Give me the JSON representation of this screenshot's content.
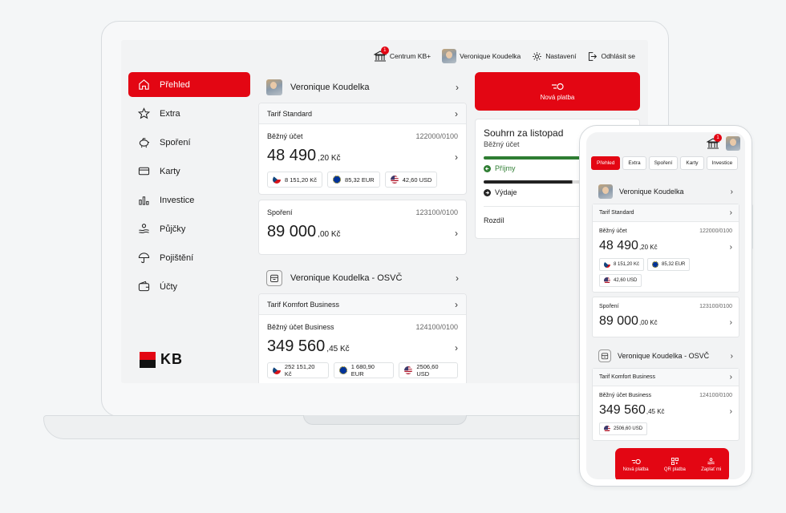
{
  "topbar": {
    "centrum_label": "Centrum KB+",
    "notification_count": "1",
    "user_name": "Veronique Koudelka",
    "settings_label": "Nastavení",
    "logout_label": "Odhlásit se"
  },
  "sidebar": {
    "items": [
      {
        "label": "Přehled",
        "icon": "home-icon"
      },
      {
        "label": "Extra",
        "icon": "star-icon"
      },
      {
        "label": "Spoření",
        "icon": "piggy-bank-icon"
      },
      {
        "label": "Karty",
        "icon": "card-icon"
      },
      {
        "label": "Investice",
        "icon": "bar-chart-icon"
      },
      {
        "label": "Půjčky",
        "icon": "loan-icon"
      },
      {
        "label": "Pojištění",
        "icon": "umbrella-icon"
      },
      {
        "label": "Účty",
        "icon": "wallet-icon"
      }
    ],
    "logo_text": "KB"
  },
  "accounts": {
    "personal": {
      "owner": "Veronique Koudelka",
      "tarif": "Tarif Standard",
      "current": {
        "name": "Běžný účet",
        "number": "122000/0100",
        "balance_int": "48 490",
        "balance_dec": ",20 Kč",
        "currencies": [
          "8 151,20 Kč",
          "85,32 EUR",
          "42,60 USD"
        ]
      },
      "savings": {
        "name": "Spoření",
        "number": "123100/0100",
        "balance_int": "89 000",
        "balance_dec": ",00 Kč"
      }
    },
    "business": {
      "owner": "Veronique Koudelka - OSVČ",
      "tarif": "Tarif Komfort Business",
      "current": {
        "name": "Běžný účet Business",
        "number": "124100/0100",
        "balance_int": "349 560",
        "balance_dec": ",45 Kč",
        "currencies": [
          "252 151,20 Kč",
          "1 680,90 EUR",
          "2506,60 USD"
        ]
      }
    }
  },
  "payment_button": "Nová platba",
  "summary": {
    "title": "Souhrn za listopad",
    "subtitle": "Běžný účet",
    "income_label": "Příjmy",
    "expense_label": "Výdaje",
    "difference_label": "Rozdíl"
  },
  "phone": {
    "tabs": [
      "Přehled",
      "Extra",
      "Spoření",
      "Karty",
      "Investice"
    ],
    "business_balance_int": "349 560",
    "business_balance_dec": ",45 Kč",
    "partial_currency": "2506,60 USD",
    "actions": [
      "Nová platba",
      "QR platba",
      "Zaplať mi"
    ]
  },
  "colors": {
    "brand_red": "#e30613",
    "income_green": "#2e7d32"
  }
}
